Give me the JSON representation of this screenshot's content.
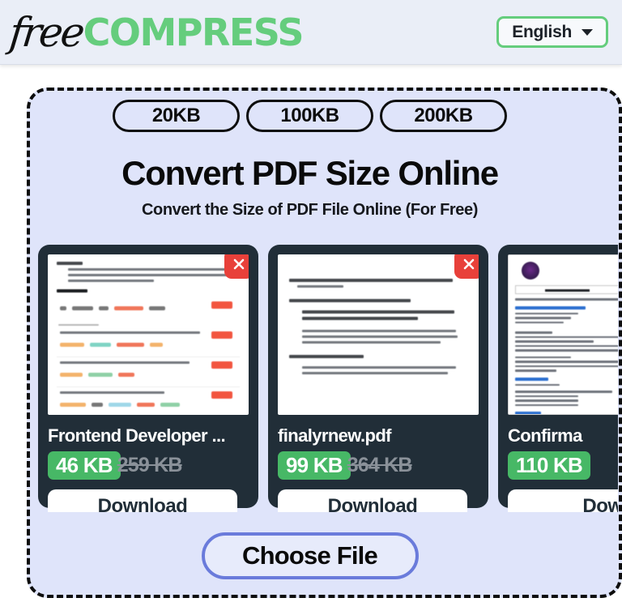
{
  "header": {
    "logo_first": "free",
    "logo_second": "COMPRESS",
    "language": "English",
    "caret_icon": "chevron-down-icon",
    "brand_green": "#65cd7d"
  },
  "dropzone": {
    "chips": [
      {
        "label": "20KB"
      },
      {
        "label": "100KB"
      },
      {
        "label": "200KB"
      }
    ],
    "title": "Convert PDF Size Online",
    "subtitle": "Convert the Size of PDF File Online (For Free)",
    "choose_file_label": "Choose File",
    "accent_border": "#6a7bdb",
    "background": "#dfe4fa"
  },
  "files": [
    {
      "name": "Frontend Developer ...",
      "new_size": "46 KB",
      "old_size": "259 KB",
      "download_label": "Download",
      "close_icon": "close-icon",
      "preview_kind": "assignment"
    },
    {
      "name": "finalyrnew.pdf",
      "new_size": "99 KB",
      "old_size": "364 KB",
      "download_label": "Download",
      "close_icon": "close-icon",
      "preview_kind": "objectives"
    },
    {
      "name": "Confirma",
      "new_size": "110 KB",
      "old_size": "",
      "download_label": "Dow",
      "close_icon": "close-icon",
      "preview_kind": "application-form"
    }
  ],
  "colors": {
    "card_background": "#212e38",
    "badge_green": "#47b866",
    "close_red": "#e8403a",
    "old_size_gray": "#8a9199"
  }
}
